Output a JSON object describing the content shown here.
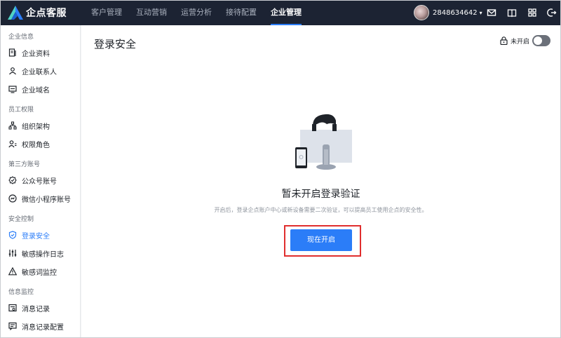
{
  "app": {
    "name": "企点客服",
    "brand_color": "#2b7df8",
    "topbar_color": "#1c2333"
  },
  "nav": [
    {
      "label": "客户管理",
      "active": false
    },
    {
      "label": "互动营销",
      "active": false
    },
    {
      "label": "运营分析",
      "active": false
    },
    {
      "label": "接待配置",
      "active": false
    },
    {
      "label": "企业管理",
      "active": true
    }
  ],
  "user": {
    "account": "2848634642"
  },
  "top_icons": [
    "mail-icon",
    "book-icon",
    "grid-icon",
    "logout-icon"
  ],
  "sidebar": {
    "groups": [
      {
        "title": "企业信息",
        "items": [
          {
            "label": "企业资料",
            "icon": "profile-card-icon"
          },
          {
            "label": "企业联系人",
            "icon": "contact-person-icon"
          },
          {
            "label": "企业域名",
            "icon": "domain-monitor-icon"
          }
        ]
      },
      {
        "title": "员工权限",
        "items": [
          {
            "label": "组织架构",
            "icon": "org-chart-icon"
          },
          {
            "label": "权限角色",
            "icon": "role-permission-icon"
          }
        ]
      },
      {
        "title": "第三方账号",
        "items": [
          {
            "label": "公众号账号",
            "icon": "official-account-icon"
          },
          {
            "label": "微信小程序账号",
            "icon": "mini-program-icon"
          }
        ]
      },
      {
        "title": "安全控制",
        "items": [
          {
            "label": "登录安全",
            "icon": "shield-check-icon",
            "active": true
          },
          {
            "label": "敏感操作日志",
            "icon": "sliders-icon"
          },
          {
            "label": "敏感词监控",
            "icon": "warning-triangle-icon"
          }
        ]
      },
      {
        "title": "信息监控",
        "items": [
          {
            "label": "消息记录",
            "icon": "message-record-icon"
          },
          {
            "label": "消息记录配置",
            "icon": "message-config-icon"
          }
        ]
      }
    ]
  },
  "main": {
    "title": "登录安全",
    "toggle_label": "未开启",
    "toggle_on": false,
    "empty_title": "暂未开启登录验证",
    "empty_desc": "开启后，登录企点账户中心或新设备需要二次验证，可以提高员工使用企点的安全性。",
    "enable_button": "现在开启",
    "highlight_color": "#e02e2e"
  }
}
